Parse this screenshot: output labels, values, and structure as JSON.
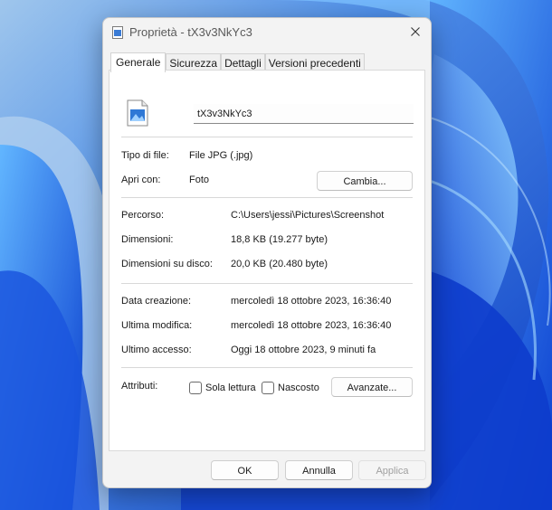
{
  "window": {
    "title": "Proprietà - tX3v3NkYc3"
  },
  "tabs": [
    {
      "label": "Generale"
    },
    {
      "label": "Sicurezza"
    },
    {
      "label": "Dettagli"
    },
    {
      "label": "Versioni precedenti"
    }
  ],
  "general": {
    "file_name": "tX3v3NkYc3",
    "file_type_label": "Tipo di file:",
    "file_type_value": "File JPG (.jpg)",
    "open_with_label": "Apri con:",
    "open_with_value": "Foto",
    "change_button": "Cambia...",
    "location_label": "Percorso:",
    "location_value": "C:\\Users\\jessi\\Pictures\\Screenshot",
    "size_label": "Dimensioni:",
    "size_value": "18,8 KB (19.277 byte)",
    "size_on_disk_label": "Dimensioni su disco:",
    "size_on_disk_value": "20,0 KB (20.480 byte)",
    "created_label": "Data creazione:",
    "created_value": "mercoledì 18 ottobre 2023, 16:36:40",
    "modified_label": "Ultima modifica:",
    "modified_value": "mercoledì 18 ottobre 2023, 16:36:40",
    "accessed_label": "Ultimo accesso:",
    "accessed_value": "Oggi 18 ottobre 2023, 9 minuti fa",
    "attributes_label": "Attributi:",
    "readonly_label": "Sola lettura",
    "hidden_label": "Nascosto",
    "advanced_button": "Avanzate..."
  },
  "footer": {
    "ok": "OK",
    "cancel": "Annulla",
    "apply": "Applica"
  },
  "icons": {
    "title": "image-file-icon",
    "close": "close-icon",
    "file": "image-file-icon"
  },
  "colors": {
    "accent": "#2e6fe0",
    "dialog_bg": "#f3f3f3"
  }
}
